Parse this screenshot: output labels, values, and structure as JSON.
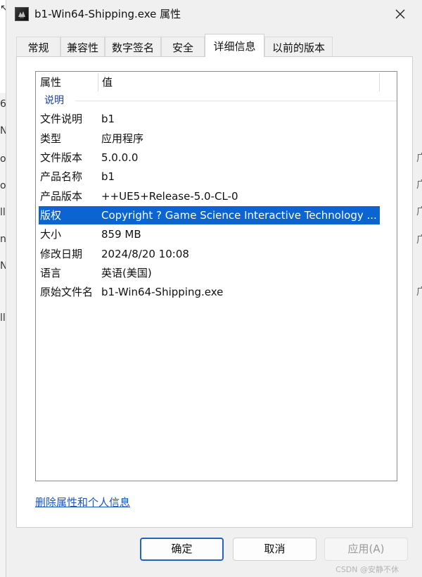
{
  "background": {
    "fragments_left": [
      "↖",
      "6-",
      "N",
      "o_",
      "os",
      "ll",
      "na",
      "N",
      "ll"
    ],
    "fragments_right": [
      "广",
      "广",
      "广",
      "广",
      "广"
    ]
  },
  "window": {
    "title": "b1-Win64-Shipping.exe 属性",
    "icon": "app-icon",
    "close_icon": "close-icon"
  },
  "tabs": [
    {
      "label": "常规",
      "active": false
    },
    {
      "label": "兼容性",
      "active": false
    },
    {
      "label": "数字签名",
      "active": false
    },
    {
      "label": "安全",
      "active": false
    },
    {
      "label": "详细信息",
      "active": true
    },
    {
      "label": "以前的版本",
      "active": false
    }
  ],
  "details": {
    "columns": {
      "property": "属性",
      "value": "值"
    },
    "group": "说明",
    "rows": [
      {
        "key": "文件说明",
        "value": "b1"
      },
      {
        "key": "类型",
        "value": "应用程序"
      },
      {
        "key": "文件版本",
        "value": "5.0.0.0"
      },
      {
        "key": "产品名称",
        "value": "b1"
      },
      {
        "key": "产品版本",
        "value": "++UE5+Release-5.0-CL-0"
      },
      {
        "key": "版权",
        "value": "Copyright ? Game Science Interactive Technology ...",
        "selected": true
      },
      {
        "key": "大小",
        "value": "859 MB"
      },
      {
        "key": "修改日期",
        "value": "2024/8/20 10:08"
      },
      {
        "key": "语言",
        "value": "英语(美国)"
      },
      {
        "key": "原始文件名",
        "value": "b1-Win64-Shipping.exe"
      }
    ]
  },
  "remove_link": "删除属性和个人信息",
  "buttons": {
    "ok": "确定",
    "cancel": "取消",
    "apply": "应用(A)"
  },
  "watermark": "CSDN @安静不休"
}
